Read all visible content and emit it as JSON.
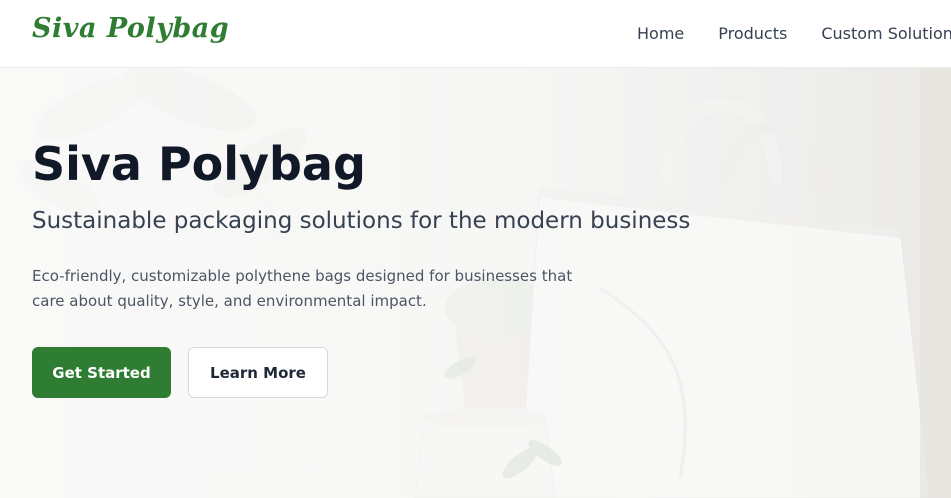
{
  "header": {
    "logo": "Siva Polybag",
    "nav": [
      {
        "label": "Home"
      },
      {
        "label": "Products"
      },
      {
        "label": "Custom Solutions"
      }
    ]
  },
  "hero": {
    "title": "Siva Polybag",
    "subtitle": "Sustainable packaging solutions for the modern business",
    "description": "Eco-friendly, customizable polythene bags designed for businesses that care about quality, style, and environmental impact.",
    "primary_button": "Get Started",
    "secondary_button": "Learn More"
  },
  "colors": {
    "brand": "#2e7d32",
    "heading": "#111827",
    "text": "#374151"
  }
}
